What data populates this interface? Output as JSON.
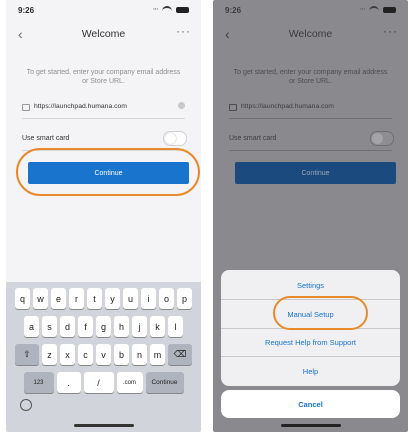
{
  "left_screen": {
    "status": {
      "time": "9:26",
      "signal": "∙∙∙"
    },
    "nav": {
      "back": "‹",
      "title": "Welcome",
      "more": "···"
    },
    "instructions": "To get started, enter your company email address or Store URL.",
    "url_value": "https://launchpad.humana.com",
    "smart_card_label": "Use smart card",
    "continue_label": "Continue",
    "keyboard": {
      "row1": [
        "q",
        "w",
        "e",
        "r",
        "t",
        "y",
        "u",
        "i",
        "o",
        "p"
      ],
      "row2": [
        "a",
        "s",
        "d",
        "f",
        "g",
        "h",
        "j",
        "k",
        "l"
      ],
      "row3_letters": [
        "z",
        "x",
        "c",
        "v",
        "b",
        "n",
        "m"
      ],
      "shift": "⇧",
      "backspace": "⌫",
      "numbers": "123",
      "dot": ".",
      "slash": "/",
      "dotcom": ".com",
      "continue": "Continue"
    }
  },
  "right_screen": {
    "status": {
      "time": "9:26",
      "signal": "∙∙∙"
    },
    "nav": {
      "back": "‹",
      "title": "Welcome",
      "more": "···"
    },
    "instructions": "To get started, enter your company email address or Store URL.",
    "url_value": "https://launchpad.humana.com",
    "smart_card_label": "Use smart card",
    "continue_label": "Continue",
    "action_sheet": {
      "options": [
        "Settings",
        "Manual Setup",
        "Request Help from Support",
        "Help"
      ],
      "cancel": "Cancel"
    }
  },
  "colors": {
    "accent": "#1874cd",
    "highlight": "#e8892a",
    "link": "#1772d0"
  }
}
